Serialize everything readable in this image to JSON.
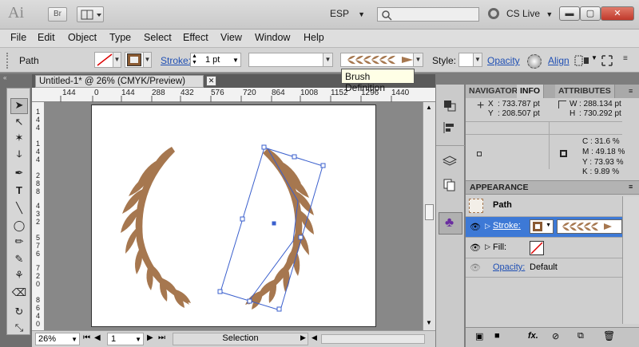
{
  "titlebar": {
    "app_logo": "Ai",
    "bridge_button": "Br",
    "workspace": "ESP",
    "search_placeholder": "",
    "cs_live": "CS Live"
  },
  "menu": [
    "File",
    "Edit",
    "Object",
    "Type",
    "Select",
    "Effect",
    "View",
    "Window",
    "Help"
  ],
  "control": {
    "object_label": "Path",
    "stroke_label": "Stroke:",
    "stroke_weight": "1 pt",
    "style_label": "Style:",
    "opacity_label": "Opacity",
    "align_label": "Align",
    "tooltip": "Brush Definition"
  },
  "document": {
    "tab_title": "Untitled-1* @ 26% (CMYK/Preview)",
    "ruler_labels": [
      "144",
      "0",
      "144",
      "288",
      "432",
      "576",
      "720",
      "864",
      "1008",
      "1152",
      "1296",
      "1440"
    ],
    "vruler_labels": [
      "1",
      "4",
      "4",
      "1",
      "4",
      "4",
      "2",
      "8",
      "8",
      "4",
      "3",
      "2",
      "5",
      "7",
      "6",
      "7",
      "2",
      "0",
      "8",
      "6",
      "4",
      "0"
    ],
    "zoom": "26%",
    "page_number": "1",
    "status": "Selection"
  },
  "panels": {
    "tabs": [
      "NAVIGATOR",
      "INFO",
      "ATTRIBUTES"
    ],
    "info": {
      "x_label": "X",
      "x": ": 733.787 pt",
      "y_label": "Y",
      "y": ": 208.507 pt",
      "w_label": "W",
      "w": ": 288.134 pt",
      "h_label": "H",
      "h": ": 730.292 pt",
      "c": "C : 31.6 %",
      "m": "M : 49.18 %",
      "yc": "Y : 73.93 %",
      "k": "K : 9.89 %"
    },
    "appearance": {
      "title": "APPEARANCE",
      "object": "Path",
      "stroke_label": "Stroke:",
      "fill_label": "Fill:",
      "opacity_label": "Opacity:",
      "opacity_value": "Default"
    }
  },
  "colors": {
    "brush": "#a6774f",
    "selection": "#3a5fcd",
    "accent_link": "#1f4fb4"
  }
}
